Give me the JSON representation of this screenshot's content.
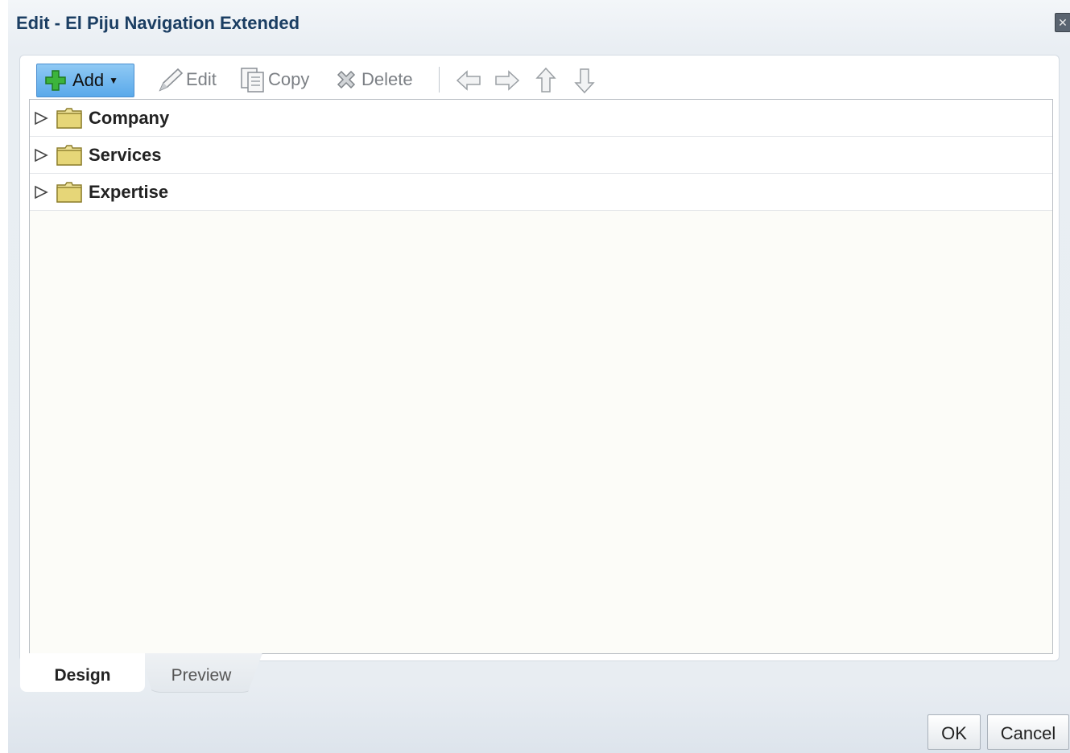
{
  "dialog": {
    "title": "Edit - El Piju Navigation Extended",
    "close_icon": "close-icon"
  },
  "toolbar": {
    "add_label": "Add",
    "edit_label": "Edit",
    "copy_label": "Copy",
    "delete_label": "Delete",
    "icons": [
      "plus-icon",
      "pencil-icon",
      "copy-icon",
      "delete-icon",
      "arrow-left-icon",
      "arrow-right-icon",
      "arrow-up-icon",
      "arrow-down-icon"
    ]
  },
  "tree": {
    "items": [
      {
        "label": "Company"
      },
      {
        "label": "Services"
      },
      {
        "label": "Expertise"
      }
    ]
  },
  "tabs": [
    {
      "label": "Design",
      "selected": true
    },
    {
      "label": "Preview",
      "selected": false
    }
  ],
  "footer": {
    "ok_label": "OK",
    "cancel_label": "Cancel"
  },
  "colors": {
    "title": "#1b3e63",
    "add_button": "#6cb4ef",
    "tree_background": "#fcfcf8",
    "folder": "#e8d87a"
  }
}
